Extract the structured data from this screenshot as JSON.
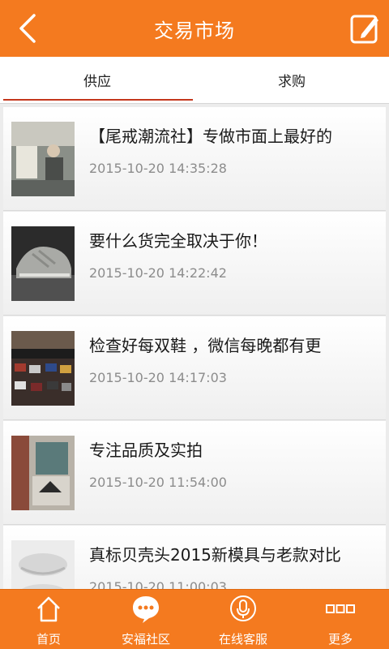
{
  "header": {
    "title": "交易市场"
  },
  "tabs": [
    {
      "label": "供应"
    },
    {
      "label": "求购"
    }
  ],
  "items": [
    {
      "title": "【尾戒潮流社】专做市面上最好的",
      "time": "2015-10-20 14:35:28"
    },
    {
      "title": "要什么货完全取决于你！",
      "time": "2015-10-20 14:22:42"
    },
    {
      "title": "检查好每双鞋 ，微信每晚都有更",
      "time": "2015-10-20 14:17:03"
    },
    {
      "title": "专注品质及实拍",
      "time": "2015-10-20 11:54:00"
    },
    {
      "title": "真标贝壳头2015新模具与老款对比",
      "time": "2015-10-20 11:00:03"
    }
  ],
  "bottom_nav": [
    {
      "label": "首页",
      "icon": "home-icon"
    },
    {
      "label": "安福社区",
      "icon": "chat-bubble-icon"
    },
    {
      "label": "在线客服",
      "icon": "microphone-icon"
    },
    {
      "label": "更多",
      "icon": "more-icon"
    }
  ],
  "colors": {
    "brand": "#f47a1f",
    "tab_indicator": "#c4371c",
    "time_text": "#8c8c8c"
  }
}
